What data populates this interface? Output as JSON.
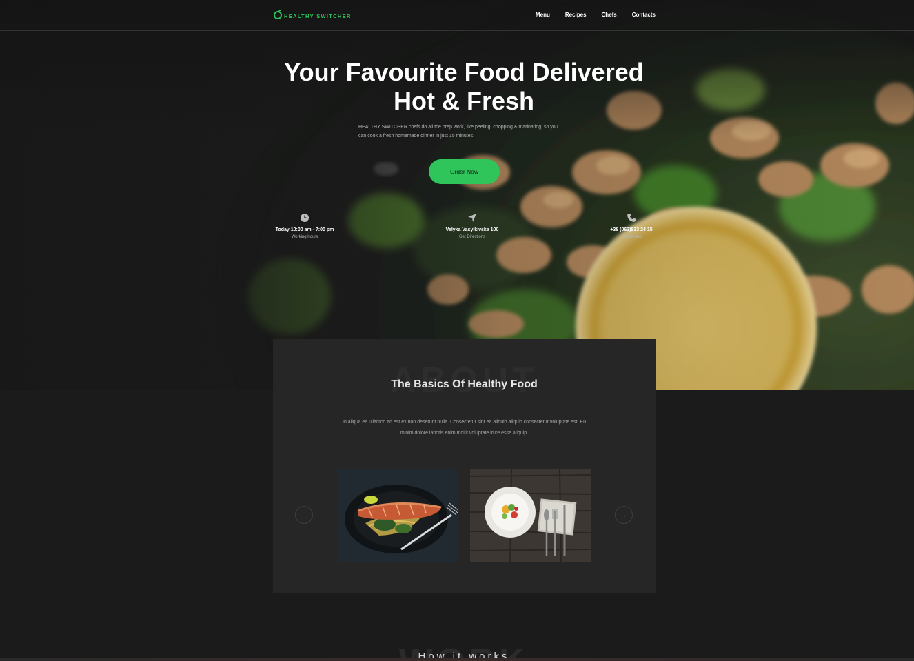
{
  "brand": {
    "name": "HEALTHY SWITCHER",
    "accent": "#2fc55a"
  },
  "nav": {
    "items": [
      "Menu",
      "Recipes",
      "Chefs",
      "Contacts"
    ]
  },
  "hero": {
    "title_part1": "Your ",
    "title_bold1": "Favourite Food",
    "title_part2": " Delivered",
    "title_line2": "Hot & Fresh",
    "subtitle": "HEALTHY SWITCHER chefs do all the prep work, like peeling, chopping & marinating, so you can cook a fresh homemade dinner in just 15 minutes.",
    "cta": "Order Now"
  },
  "info": [
    {
      "icon": "clock-icon",
      "value": "Today 10:00 am - 7:00 pm",
      "label": "Working hours"
    },
    {
      "icon": "location-arrow-icon",
      "value": "Velyka Vasylkivska 100",
      "label": "Get Directions"
    },
    {
      "icon": "phone-icon",
      "value": "+38 (063)833 24 15",
      "label": "Call Online"
    }
  ],
  "about": {
    "ghost": "ABOUT",
    "title": "The Basics Of Healthy Food",
    "text": "In aliqua ea ullamco ad est ex non deserunt nulla. Consectetur sint ea aliquip aliquip consectetur voluptate est. Eu minim dolore laboris enim mollit voluptate irure esse aliquip."
  },
  "work": {
    "ghost": "WORK",
    "title": "How it works"
  }
}
